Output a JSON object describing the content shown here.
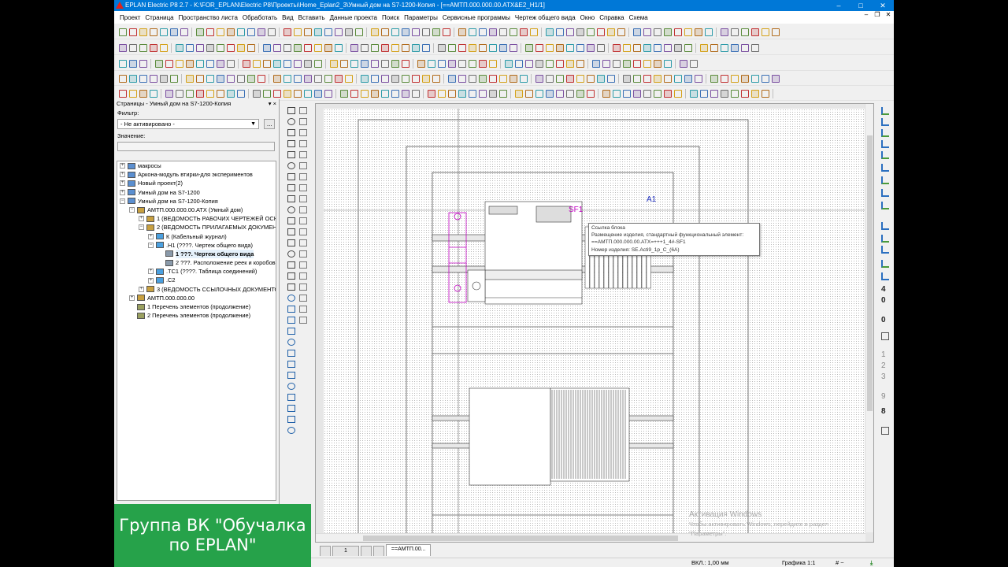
{
  "window": {
    "title": "EPLAN Electric P8 2.7 - K:\\FOR_EPLAN\\Electric P8\\Проекты\\Home_Eplan2_3\\Умный дом на S7-1200-Копия - [==АМТП.000.000.00.АТХ&E2_H1/1]",
    "minimize": "–",
    "maximize": "□",
    "close": "✕",
    "mdi_min": "–",
    "mdi_restore": "❐",
    "mdi_close": "✕"
  },
  "menu": [
    "Проект",
    "Страница",
    "Пространство листа",
    "Обработать",
    "Вид",
    "Вставить",
    "Данные проекта",
    "Поиск",
    "Параметры",
    "Сервисные программы",
    "Чертеж общего вида",
    "Окно",
    "Справка",
    "Схема"
  ],
  "sidebar": {
    "title": "Страницы - Умный дом на S7-1200-Копия",
    "title_ctl": "▾ ×",
    "filter_label": "Фильтр:",
    "filter_value": "- Не активировано -",
    "filter_btn": "...",
    "value_label": "Значение:",
    "tree": [
      {
        "level": 0,
        "exp": "+",
        "icon": "project",
        "text": "макросы"
      },
      {
        "level": 0,
        "exp": "+",
        "icon": "project",
        "text": "Аркона-модуль втирки-для экспериментов"
      },
      {
        "level": 0,
        "exp": "+",
        "icon": "project",
        "text": "Новый проект(2)"
      },
      {
        "level": 0,
        "exp": "+",
        "icon": "project",
        "text": "Умный дом на S7-1200"
      },
      {
        "level": 0,
        "exp": "−",
        "icon": "project",
        "text": "Умный дом на S7-1200-Копия"
      },
      {
        "level": 1,
        "exp": "−",
        "icon": "struct",
        "text": "АМТП.000.000.00.АТХ (Умный дом)"
      },
      {
        "level": 2,
        "exp": "+",
        "icon": "struct",
        "text": "1 (ВЕДОМОСТЬ РАБОЧИХ ЧЕРТЕЖЕЙ ОСНС"
      },
      {
        "level": 2,
        "exp": "−",
        "icon": "struct",
        "text": "2 (ВЕДОМОСТЬ ПРИЛАГАЕМЫХ ДОКУМЕНТ"
      },
      {
        "level": 3,
        "exp": "+",
        "icon": "folder",
        "text": "К (Кабельный журнал)"
      },
      {
        "level": 3,
        "exp": "−",
        "icon": "folder",
        "text": ".Н1 (????. Чертеж общего вида)"
      },
      {
        "level": 4,
        "exp": "",
        "icon": "page",
        "text": "1 ???. Чертеж общего вида",
        "selected": true
      },
      {
        "level": 4,
        "exp": "",
        "icon": "page",
        "text": "2 ???. Расположение реек и коробов"
      },
      {
        "level": 3,
        "exp": "+",
        "icon": "folder",
        "text": ".ТС1 (????. Таблица соединений)"
      },
      {
        "level": 3,
        "exp": "+",
        "icon": "folder",
        "text": ".С2"
      },
      {
        "level": 2,
        "exp": "+",
        "icon": "struct",
        "text": "3 (ВЕДОМОСТЬ ССЫЛОЧНЫХ ДОКУМЕНТО"
      },
      {
        "level": 1,
        "exp": "+",
        "icon": "struct",
        "text": "АМТП.000.000.00"
      },
      {
        "level": 1,
        "exp": "",
        "icon": "list",
        "text": "1 Перечень элементов (продолжение)"
      },
      {
        "level": 1,
        "exp": "",
        "icon": "list",
        "text": "2 Перечень элементов (продолжение)"
      }
    ]
  },
  "canvas": {
    "label_sf1": "SF1",
    "label_a1": "A1",
    "tooltip": {
      "line1": "Ссылка блока",
      "line2": "Размещение изделия, стандартный функциональный элемент:",
      "line3": "==АМТП.000.000.00.АТХ=+++1_4#-SF1",
      "line4": "Номер изделия: SE.Acti9_1p_C_(6A)"
    }
  },
  "right_numbers": [
    "4",
    "0",
    "0",
    "1",
    "2",
    "3",
    "9",
    "8"
  ],
  "tabs": [
    "1",
    "==АМТП.00..."
  ],
  "status": {
    "grid": "ВКЛ.: 1,00 мм",
    "scale": "Графика 1:1",
    "hash": "# ~"
  },
  "watermark": {
    "line1": "Активация Windows",
    "line2": "Чтобы активировать Windows, перейдите в раздел",
    "line3": "\"Параметры\"."
  },
  "banner": "Группа ВК \"Обучалка по EPLAN\"",
  "colors": {
    "titlebar": "#0078d7",
    "banner": "#26a24a",
    "macro_magenta": "#c000c0",
    "label_blue": "#2030c0"
  }
}
